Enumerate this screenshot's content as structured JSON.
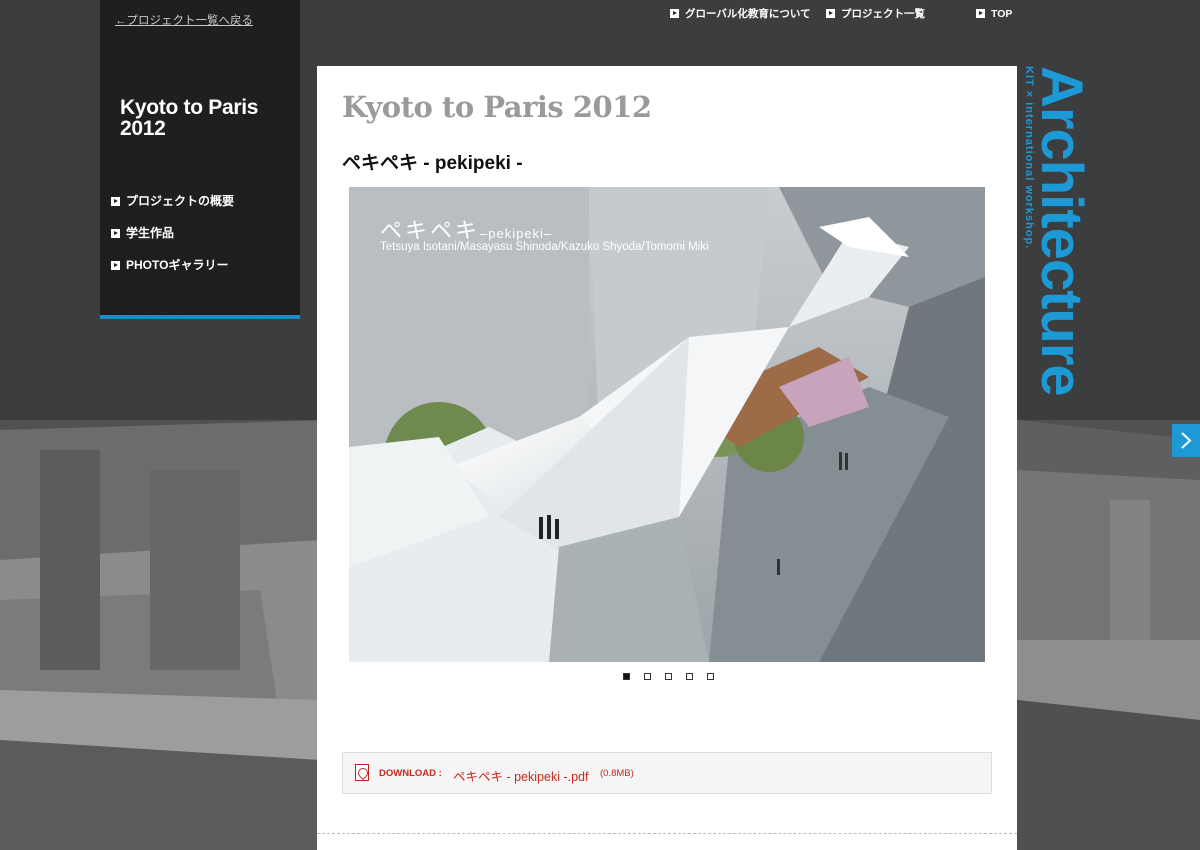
{
  "top_nav": {
    "items": [
      {
        "label": "グローバル化教育について"
      },
      {
        "label": "プロジェクト一覧"
      },
      {
        "label": "TOP"
      }
    ]
  },
  "sidebar": {
    "back_link": "←プロジェクト一覧へ戻る",
    "title": "Kyoto to Paris\n2012",
    "items": [
      {
        "label": "プロジェクトの概要"
      },
      {
        "label": "学生作品"
      },
      {
        "label": "PHOTOギャラリー"
      }
    ]
  },
  "main": {
    "heading": "Kyoto to Paris 2012",
    "subheading": "ペキペキ - pekipeki -",
    "slide": {
      "caption_title": "ペキペキ",
      "caption_title_suffix": "–pekipeki–",
      "caption_authors": "Tetsuya Isotani/Masayasu Shinoda/Kazuko Shyoda/Tomomi Miki",
      "total": 5,
      "current": 1
    },
    "download": {
      "label": "DOWNLOAD :",
      "file_name": "ペキペキ - pekipeki -.pdf",
      "file_size": "(0.8MB)"
    }
  },
  "brand": {
    "title": "Architecture",
    "tagline": "KIT × international workshop."
  },
  "colors": {
    "accent": "#1d9ad6",
    "link_red": "#c8281c",
    "panel_dark": "#1d1d1f",
    "heading_gray": "#9a9a9a"
  },
  "icons": {
    "nav_bullet": "triangle-right-icon",
    "pdf": "pdf-file-icon",
    "next": "chevron-right-icon"
  }
}
